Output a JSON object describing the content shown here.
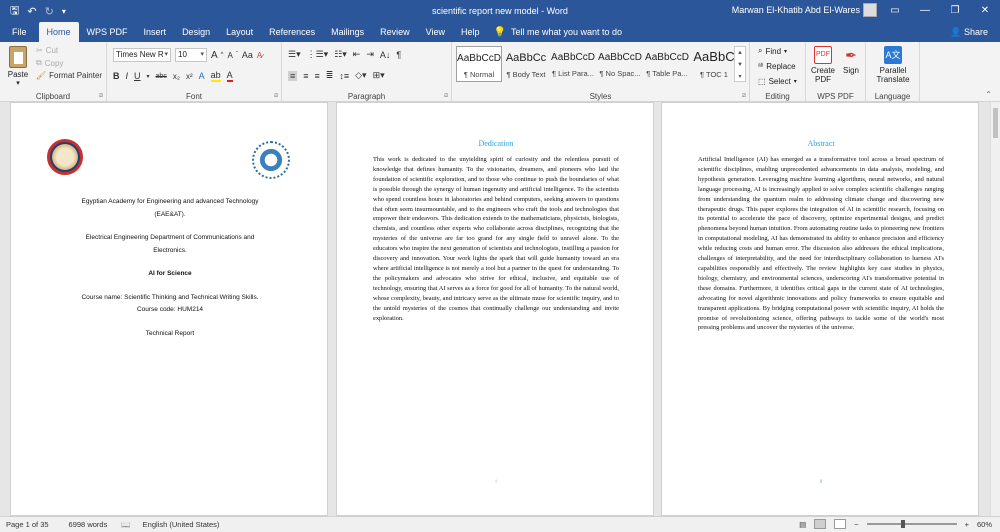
{
  "window": {
    "title": "scientific report new model  -  Word",
    "user": "Marwan El-Khatib Abd El-Wares"
  },
  "tabs": [
    "File",
    "Home",
    "WPS PDF",
    "Insert",
    "Design",
    "Layout",
    "References",
    "Mailings",
    "Review",
    "View",
    "Help"
  ],
  "tell_me": "Tell me what you want to do",
  "share": "Share",
  "clipboard": {
    "paste": "Paste",
    "cut": "Cut",
    "copy": "Copy",
    "format_painter": "Format Painter",
    "label": "Clipboard"
  },
  "font": {
    "family": "Times New R",
    "size": "10",
    "grow": "A",
    "shrink": "A",
    "case": "Aa",
    "bold": "B",
    "italic": "I",
    "underline": "U",
    "strike": "abc",
    "sub": "x₂",
    "sup": "x²",
    "label": "Font"
  },
  "paragraph": {
    "label": "Paragraph"
  },
  "styles": {
    "items": [
      {
        "sample": "AaBbCcD",
        "name": "¶ Normal"
      },
      {
        "sample": "AaBbCc",
        "name": "¶ Body Text"
      },
      {
        "sample": "AaBbCcD",
        "name": "¶ List Para..."
      },
      {
        "sample": "AaBbCcD",
        "name": "¶ No Spac..."
      },
      {
        "sample": "AaBbCcD",
        "name": "¶ Table Pa..."
      },
      {
        "sample": "AaBbC",
        "name": "¶ TOC 1"
      }
    ],
    "label": "Styles"
  },
  "editing": {
    "find": "Find",
    "replace": "Replace",
    "select": "Select",
    "label": "Editing"
  },
  "wps": {
    "create": "Create PDF",
    "sign": "Sign",
    "label": "WPS PDF"
  },
  "language": {
    "translate": "Parallel Translate",
    "label": "Language"
  },
  "page1": {
    "line1": "Egyptian Academy for Engineering and advanced Technology",
    "line2": "(EAE&AT).",
    "line3": "Electrical Engineering Department of Communications and",
    "line4": "Electronics.",
    "line5": "AI for Science",
    "line6": "Course name: Scientific Thinking and Technical Writing Skills.",
    "line7": "Course code: HUM214",
    "line8": "Technical Report"
  },
  "page2": {
    "title": "Dedication",
    "body": "This work is dedicated to the unyielding spirit of curiosity and the relentless pursuit of knowledge that defines humanity. To the visionaries, dreamers, and pioneers who laid the foundation of scientific exploration, and to those who continue to push the boundaries of what is possible through the synergy of human ingenuity and artificial intelligence. To the scientists who spend countless hours in laboratories and behind computers, seeking answers to questions that often seem insurmountable, and to the engineers who craft the tools and technologies that empower their endeavors. This dedication extends to the mathematicians, physicists, biologists, chemists, and countless other experts who collaborate across disciplines, recognizing that the mysteries of the universe are far too grand for any single field to unravel alone. To the educators who inspire the next generation of scientists and technologists, instilling a passion for discovery and innovation. Your work lights the spark that will guide humanity toward an era where artificial intelligence is not merely a tool but a partner in the quest for understanding. To the policymakers and advocates who strive for ethical, inclusive, and equitable use of technology, ensuring that AI serves as a force for good for all of humanity. To the natural world, whose complexity, beauty, and intricacy serve as the ultimate muse for scientific inquiry, and to the untold mysteries of the cosmos that continually challenge our understanding and invite exploration.",
    "page_number": "i"
  },
  "page3": {
    "title": "Abstract",
    "body": "Artificial Intelligence (AI) has emerged as a transformative tool across a broad spectrum of scientific disciplines, enabling unprecedented advancements in data analysis, modeling, and hypothesis generation. Leveraging machine learning algorithms, neural networks, and natural language processing, AI is increasingly applied to solve complex scientific challenges ranging from understanding the quantum realm to addressing climate change and discovering new therapeutic drugs. This paper explores the integration of AI in scientific research, focusing on its potential to accelerate the pace of discovery, optimize experimental designs, and predict phenomena beyond human intuition. From automating routine tasks to pioneering new frontiers in computational modeling, AI has demonstrated its ability to enhance precision and efficiency while reducing costs and human error. The discussion also addresses the ethical implications, challenges of interpretability, and the need for interdisciplinary collaboration to harness AI's capabilities responsibly and effectively. The review highlights key case studies in physics, biology, chemistry, and environmental sciences, underscoring AI's transformative potential in these domains. Furthermore, it identifies critical gaps in the current state of AI technologies, advocating for novel algorithmic innovations and policy frameworks to ensure equitable and transparent applications. By bridging computational power with scientific inquiry, AI holds the promise of revolutionizing science, offering pathways to tackle some of the world's most pressing problems and uncover the mysteries of the universe.",
    "page_number": "ii"
  },
  "status": {
    "page": "Page 1 of 35",
    "words": "6998 words",
    "language": "English (United States)",
    "zoom": "60%"
  }
}
